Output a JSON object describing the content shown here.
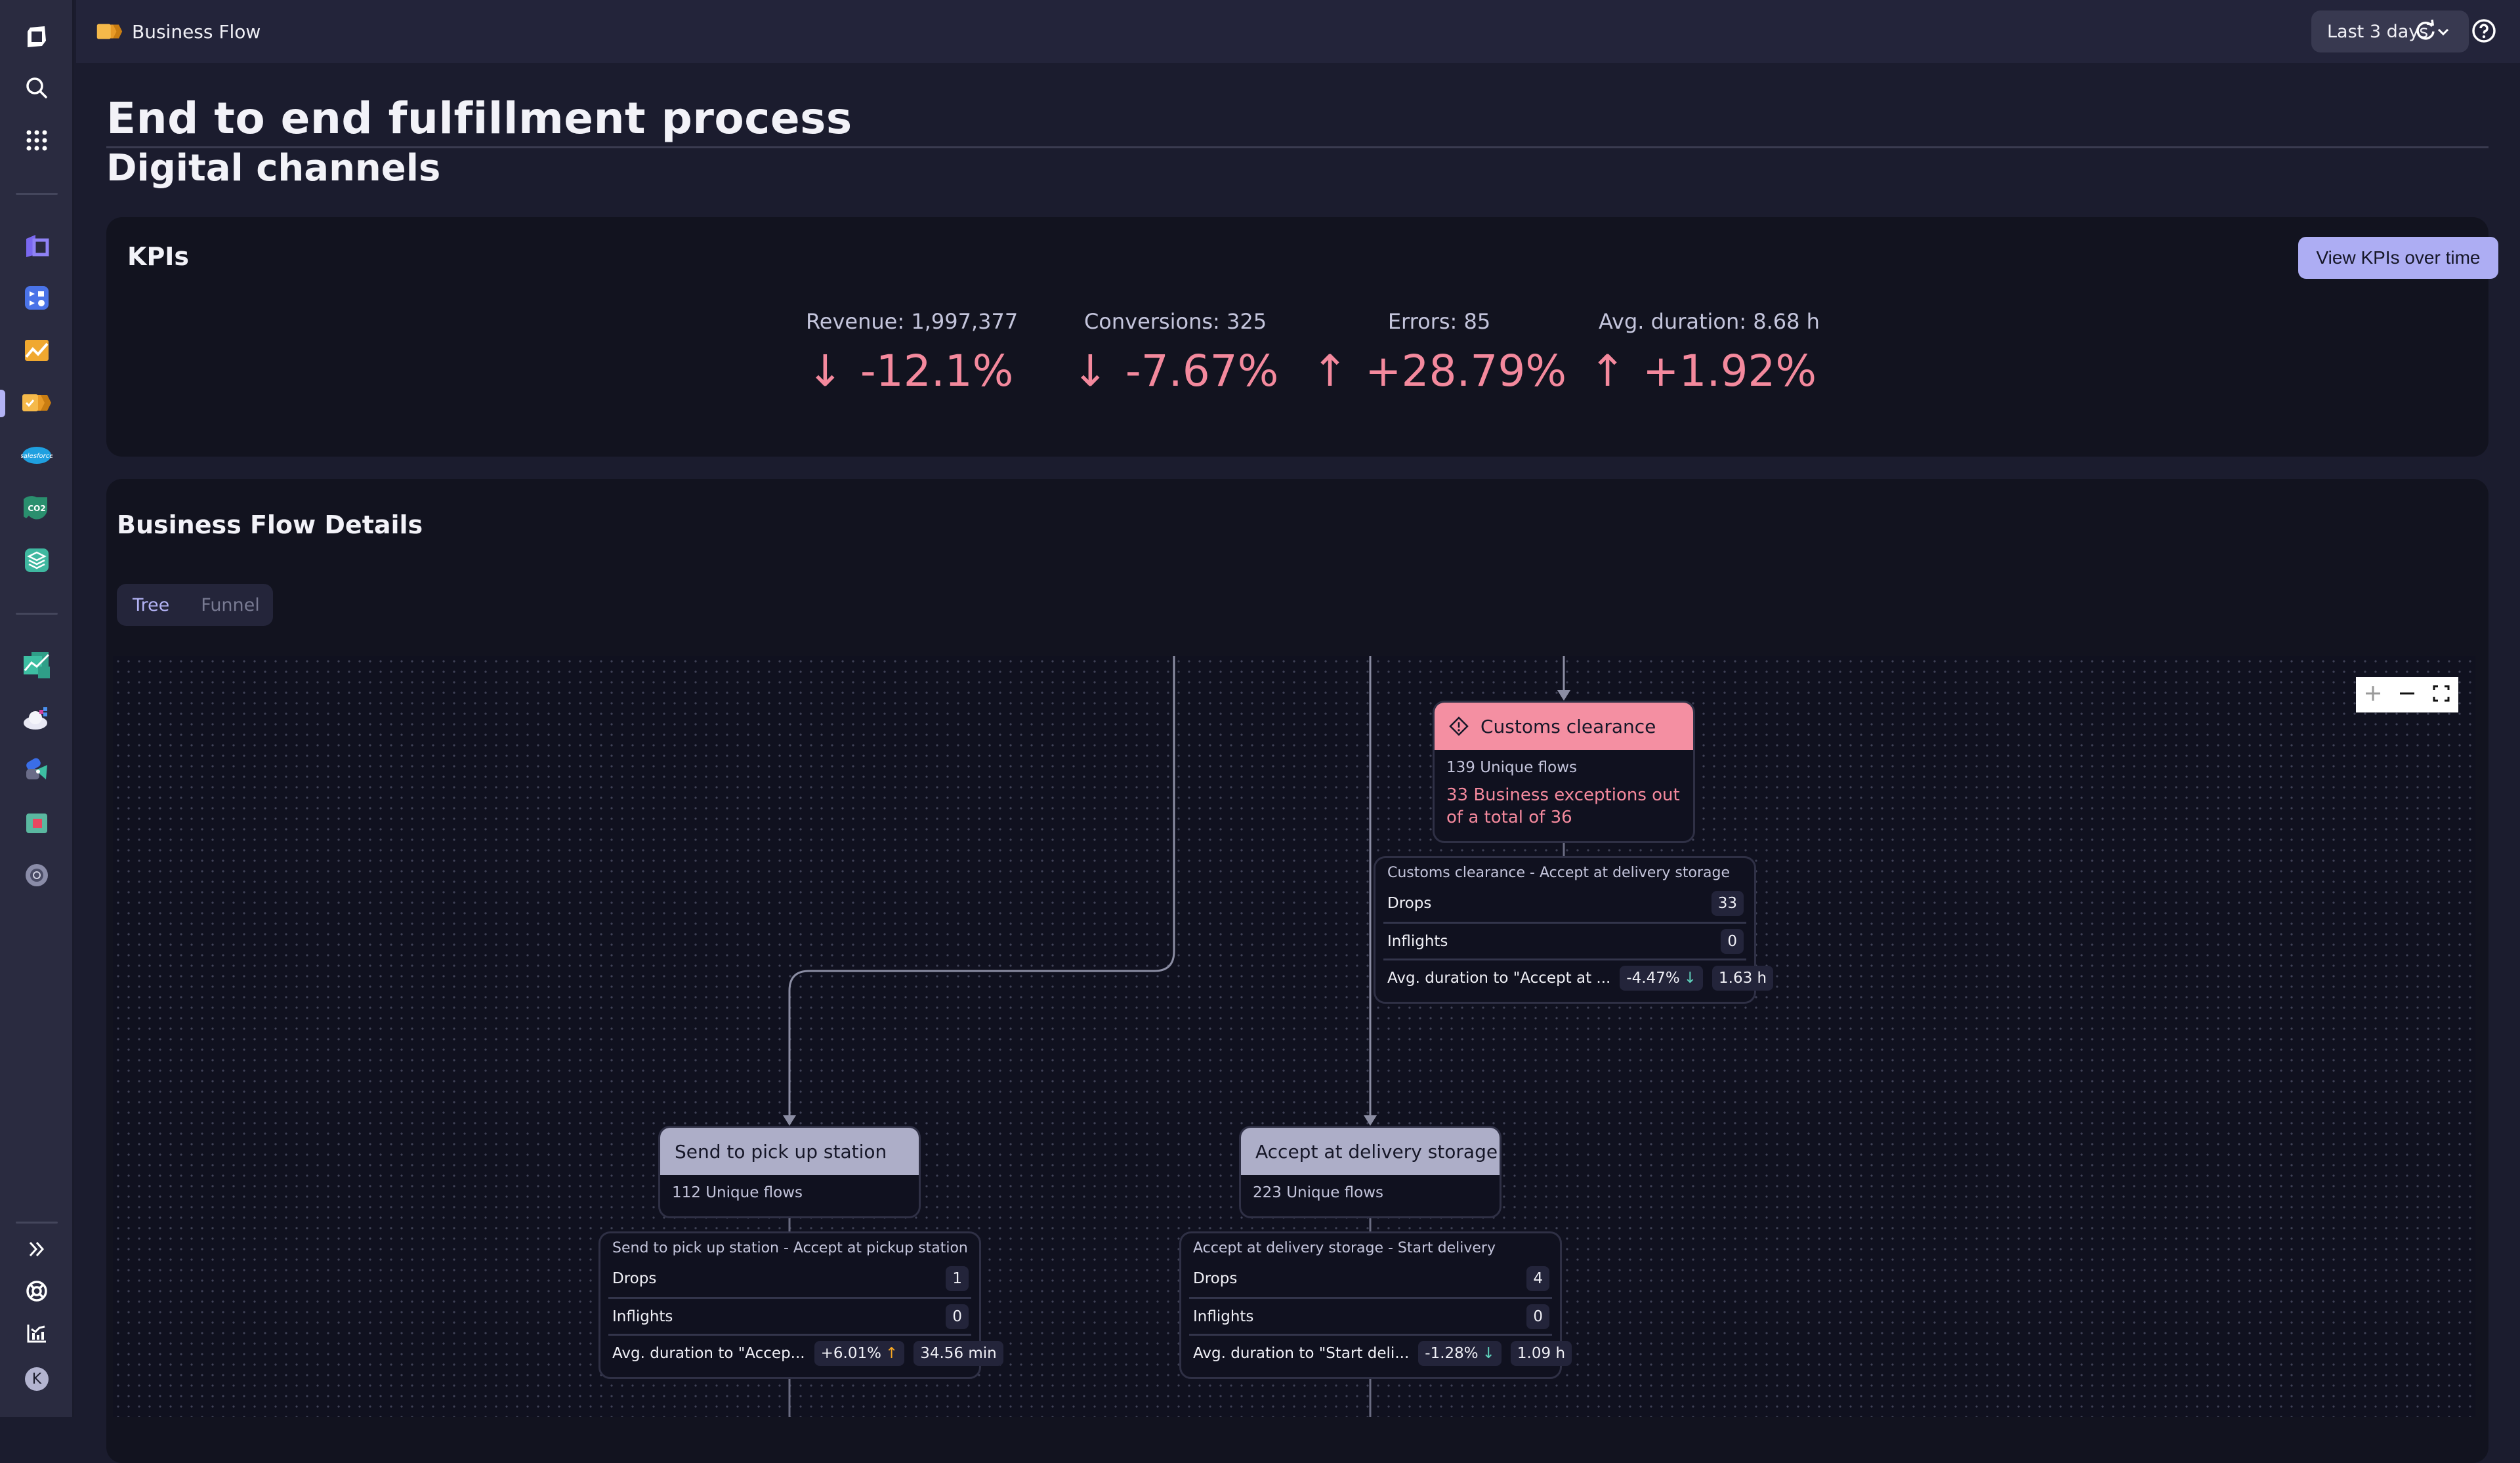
{
  "app": {
    "name": "Business Flow"
  },
  "topbar": {
    "timeframe": "Last 3 days"
  },
  "page": {
    "title": "End to end fulfillment process",
    "subtitle": "Digital channels"
  },
  "kpis": {
    "title": "KPIs",
    "button": "View KPIs over time",
    "items": [
      {
        "label": "Revenue: 1,997,377",
        "change": "-12.1%",
        "direction": "down"
      },
      {
        "label": "Conversions: 325",
        "change": "-7.67%",
        "direction": "down"
      },
      {
        "label": "Errors: 85",
        "change": "+28.79%",
        "direction": "up"
      },
      {
        "label": "Avg. duration: 8.68 h",
        "change": "+1.92%",
        "direction": "up"
      }
    ],
    "color": "#f4899d"
  },
  "details": {
    "title": "Business Flow Details",
    "tabs": [
      {
        "label": "Tree",
        "active": true
      },
      {
        "label": "Funnel",
        "active": false
      }
    ],
    "nodes": [
      {
        "name": "Customs clearance",
        "status": "error",
        "flows": "139 Unique flows",
        "exceptions": "33 Business exceptions out of a total of 36"
      },
      {
        "name": "Send to pick up station",
        "status": "ok",
        "flows": "112 Unique flows"
      },
      {
        "name": "Accept at delivery storage",
        "status": "ok",
        "flows": "223 Unique flows"
      }
    ],
    "transitions": [
      {
        "title": "Customs clearance - Accept at delivery storage",
        "drops_label": "Drops",
        "drops": "33",
        "inflights_label": "Inflights",
        "inflights": "0",
        "avg_label": "Avg. duration to \"Accept at ...",
        "change": "-4.47%",
        "change_dir": "down",
        "duration": "1.63 h"
      },
      {
        "title": "Send to pick up station - Accept at pickup station",
        "drops_label": "Drops",
        "drops": "1",
        "inflights_label": "Inflights",
        "inflights": "0",
        "avg_label": "Avg. duration to \"Accep...",
        "change": "+6.01%",
        "change_dir": "up",
        "duration": "34.56 min"
      },
      {
        "title": "Accept at delivery storage - Start delivery",
        "drops_label": "Drops",
        "drops": "4",
        "inflights_label": "Inflights",
        "inflights": "0",
        "avg_label": "Avg. duration to \"Start deli...",
        "change": "-1.28%",
        "change_dir": "down",
        "duration": "1.09 h"
      }
    ],
    "colors": {
      "down_good": "#5fd4bd",
      "up_warn": "#f5a623",
      "error": "#f48fa2"
    }
  },
  "sidebar": {
    "user_initial": "K",
    "apps": [
      "Dynatrace",
      "Search",
      "Apps",
      "Kubernetes",
      "Workflows",
      "Dashboards",
      "Business Flow",
      "Salesforce",
      "Carbon Impact",
      "Stack",
      "Reports",
      "Cloud",
      "Shapes",
      "Cubes",
      "Settings"
    ]
  }
}
